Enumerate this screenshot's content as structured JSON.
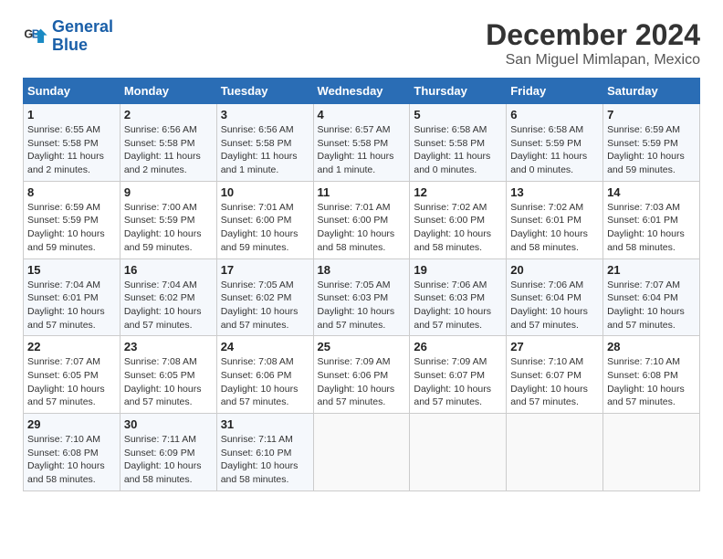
{
  "header": {
    "logo_line1": "General",
    "logo_line2": "Blue",
    "month": "December 2024",
    "location": "San Miguel Mimlapan, Mexico"
  },
  "weekdays": [
    "Sunday",
    "Monday",
    "Tuesday",
    "Wednesday",
    "Thursday",
    "Friday",
    "Saturday"
  ],
  "weeks": [
    [
      {
        "day": "1",
        "info": "Sunrise: 6:55 AM\nSunset: 5:58 PM\nDaylight: 11 hours and 2 minutes."
      },
      {
        "day": "2",
        "info": "Sunrise: 6:56 AM\nSunset: 5:58 PM\nDaylight: 11 hours and 2 minutes."
      },
      {
        "day": "3",
        "info": "Sunrise: 6:56 AM\nSunset: 5:58 PM\nDaylight: 11 hours and 1 minute."
      },
      {
        "day": "4",
        "info": "Sunrise: 6:57 AM\nSunset: 5:58 PM\nDaylight: 11 hours and 1 minute."
      },
      {
        "day": "5",
        "info": "Sunrise: 6:58 AM\nSunset: 5:58 PM\nDaylight: 11 hours and 0 minutes."
      },
      {
        "day": "6",
        "info": "Sunrise: 6:58 AM\nSunset: 5:59 PM\nDaylight: 11 hours and 0 minutes."
      },
      {
        "day": "7",
        "info": "Sunrise: 6:59 AM\nSunset: 5:59 PM\nDaylight: 10 hours and 59 minutes."
      }
    ],
    [
      {
        "day": "8",
        "info": "Sunrise: 6:59 AM\nSunset: 5:59 PM\nDaylight: 10 hours and 59 minutes."
      },
      {
        "day": "9",
        "info": "Sunrise: 7:00 AM\nSunset: 5:59 PM\nDaylight: 10 hours and 59 minutes."
      },
      {
        "day": "10",
        "info": "Sunrise: 7:01 AM\nSunset: 6:00 PM\nDaylight: 10 hours and 59 minutes."
      },
      {
        "day": "11",
        "info": "Sunrise: 7:01 AM\nSunset: 6:00 PM\nDaylight: 10 hours and 58 minutes."
      },
      {
        "day": "12",
        "info": "Sunrise: 7:02 AM\nSunset: 6:00 PM\nDaylight: 10 hours and 58 minutes."
      },
      {
        "day": "13",
        "info": "Sunrise: 7:02 AM\nSunset: 6:01 PM\nDaylight: 10 hours and 58 minutes."
      },
      {
        "day": "14",
        "info": "Sunrise: 7:03 AM\nSunset: 6:01 PM\nDaylight: 10 hours and 58 minutes."
      }
    ],
    [
      {
        "day": "15",
        "info": "Sunrise: 7:04 AM\nSunset: 6:01 PM\nDaylight: 10 hours and 57 minutes."
      },
      {
        "day": "16",
        "info": "Sunrise: 7:04 AM\nSunset: 6:02 PM\nDaylight: 10 hours and 57 minutes."
      },
      {
        "day": "17",
        "info": "Sunrise: 7:05 AM\nSunset: 6:02 PM\nDaylight: 10 hours and 57 minutes."
      },
      {
        "day": "18",
        "info": "Sunrise: 7:05 AM\nSunset: 6:03 PM\nDaylight: 10 hours and 57 minutes."
      },
      {
        "day": "19",
        "info": "Sunrise: 7:06 AM\nSunset: 6:03 PM\nDaylight: 10 hours and 57 minutes."
      },
      {
        "day": "20",
        "info": "Sunrise: 7:06 AM\nSunset: 6:04 PM\nDaylight: 10 hours and 57 minutes."
      },
      {
        "day": "21",
        "info": "Sunrise: 7:07 AM\nSunset: 6:04 PM\nDaylight: 10 hours and 57 minutes."
      }
    ],
    [
      {
        "day": "22",
        "info": "Sunrise: 7:07 AM\nSunset: 6:05 PM\nDaylight: 10 hours and 57 minutes."
      },
      {
        "day": "23",
        "info": "Sunrise: 7:08 AM\nSunset: 6:05 PM\nDaylight: 10 hours and 57 minutes."
      },
      {
        "day": "24",
        "info": "Sunrise: 7:08 AM\nSunset: 6:06 PM\nDaylight: 10 hours and 57 minutes."
      },
      {
        "day": "25",
        "info": "Sunrise: 7:09 AM\nSunset: 6:06 PM\nDaylight: 10 hours and 57 minutes."
      },
      {
        "day": "26",
        "info": "Sunrise: 7:09 AM\nSunset: 6:07 PM\nDaylight: 10 hours and 57 minutes."
      },
      {
        "day": "27",
        "info": "Sunrise: 7:10 AM\nSunset: 6:07 PM\nDaylight: 10 hours and 57 minutes."
      },
      {
        "day": "28",
        "info": "Sunrise: 7:10 AM\nSunset: 6:08 PM\nDaylight: 10 hours and 57 minutes."
      }
    ],
    [
      {
        "day": "29",
        "info": "Sunrise: 7:10 AM\nSunset: 6:08 PM\nDaylight: 10 hours and 58 minutes."
      },
      {
        "day": "30",
        "info": "Sunrise: 7:11 AM\nSunset: 6:09 PM\nDaylight: 10 hours and 58 minutes."
      },
      {
        "day": "31",
        "info": "Sunrise: 7:11 AM\nSunset: 6:10 PM\nDaylight: 10 hours and 58 minutes."
      },
      {
        "day": "",
        "info": ""
      },
      {
        "day": "",
        "info": ""
      },
      {
        "day": "",
        "info": ""
      },
      {
        "day": "",
        "info": ""
      }
    ]
  ]
}
